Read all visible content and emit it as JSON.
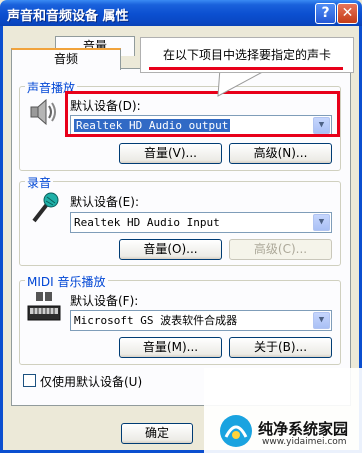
{
  "window": {
    "title": "声音和音频设备  属性",
    "help_label": "?",
    "close_label": "✕"
  },
  "tabs": [
    {
      "label": "音量"
    },
    {
      "label": "音频",
      "active": true
    }
  ],
  "callout": {
    "text": "在以下项目中选择要指定的声卡"
  },
  "groups": {
    "playback": {
      "title": "声音播放",
      "default_device_label": "默认设备(D):",
      "device_value": "Realtek HD Audio output",
      "volume_button": "音量(V)...",
      "advanced_button": "高级(N)..."
    },
    "recording": {
      "title": "录音",
      "default_device_label": "默认设备(E):",
      "device_value": "Realtek HD Audio Input",
      "volume_button": "音量(O)...",
      "advanced_button": "高级(C)..."
    },
    "midi": {
      "title": "MIDI 音乐播放",
      "default_device_label": "默认设备(F):",
      "device_value": "Microsoft GS 波表软件合成器",
      "volume_button": "音量(M)...",
      "about_button": "关于(B)..."
    }
  },
  "checkbox": {
    "label": "仅使用默认设备(U)",
    "checked": false
  },
  "footer": {
    "ok_button": "确定"
  },
  "watermark": {
    "title": "纯净系统家园",
    "url": "www.yidaimei.com"
  },
  "colors": {
    "highlight": "#e8001a",
    "title_bar": "#0b4fd0",
    "group_title": "#0046d5"
  }
}
